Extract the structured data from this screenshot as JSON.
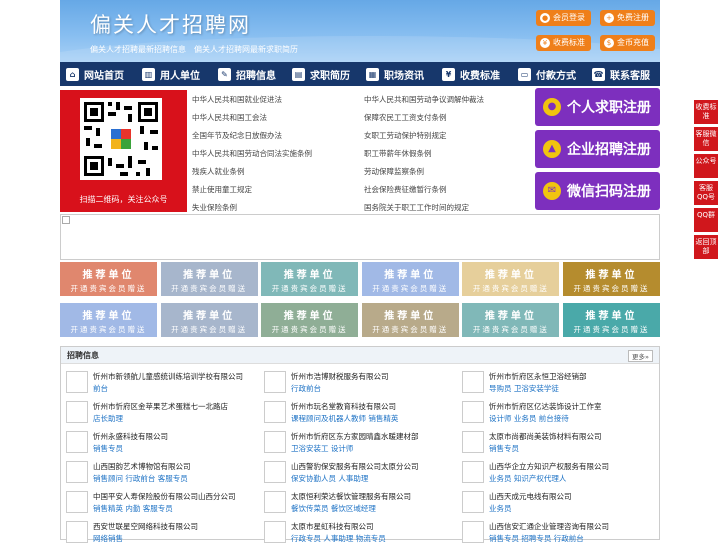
{
  "header": {
    "title": "偏关人才招聘网",
    "subtitle": "偏关人才招聘最新招聘信息　偏关人才招聘网最新求职简历",
    "buttons": [
      {
        "label": "会员登录",
        "icon": "user-icon"
      },
      {
        "label": "免费注册",
        "icon": "register-icon"
      },
      {
        "label": "收费标准",
        "icon": "price-icon"
      },
      {
        "label": "金币充值",
        "icon": "coin-icon"
      }
    ]
  },
  "nav": [
    {
      "label": "网站首页",
      "icon": "home-icon"
    },
    {
      "label": "用人单位",
      "icon": "building-icon"
    },
    {
      "label": "招聘信息",
      "icon": "recruit-icon"
    },
    {
      "label": "求职简历",
      "icon": "resume-icon"
    },
    {
      "label": "职场资讯",
      "icon": "news-icon"
    },
    {
      "label": "收费标准",
      "icon": "price-icon"
    },
    {
      "label": "付款方式",
      "icon": "payment-icon"
    },
    {
      "label": "联系客服",
      "icon": "phone-icon"
    }
  ],
  "qr": {
    "caption": "扫描二维码，关注公众号"
  },
  "laws": [
    "中华人民共和国就业促进法",
    "中华人民共和国劳动争议调解仲裁法",
    "中华人民共和国工会法",
    "保障农民工工资支付条例",
    "全国年节及纪念日放假办法",
    "女职工劳动保护特别规定",
    "中华人民共和国劳动合同法实施条例",
    "职工带薪年休假条例",
    "残疾人就业条例",
    "劳动保障监察条例",
    "禁止使用童工规定",
    "社会保险费征缴暂行条例",
    "失业保险条例",
    "国务院关于职工工作时间的规定"
  ],
  "register": [
    {
      "label": "个人求职注册",
      "icon": "person-icon"
    },
    {
      "label": "企业招聘注册",
      "icon": "company-icon"
    },
    {
      "label": "微信扫码注册",
      "icon": "wechat-icon"
    }
  ],
  "promo": {
    "title": "推荐单位",
    "sub": "开通贵宾会员赠送",
    "colors": [
      "#e0876e",
      "#a7b6cc",
      "#80b8b8",
      "#a1b9e6",
      "#e6cf9b",
      "#b58c2e",
      "#a1b9e6",
      "#a7b6cc",
      "#8fae96",
      "#b8aa8a",
      "#80b8b8",
      "#4aa9a9"
    ]
  },
  "jobs": {
    "title": "招聘信息",
    "more": "更多»",
    "items": [
      {
        "company": "忻州市新领航儿童感统训练培训学校有限公司",
        "posts": "前台"
      },
      {
        "company": "忻州市浩博财税服务有限公司",
        "posts": "行政前台"
      },
      {
        "company": "忻州市忻府区永恒卫浴经销部",
        "posts": "导购员 卫浴安装学徒"
      },
      {
        "company": "忻州市忻府区金苹果艺术蛋糕七一北路店",
        "posts": "店长助理"
      },
      {
        "company": "忻州市玩名堂教育科技有限公司",
        "posts": "课程顾问及机器人教师 销售精英"
      },
      {
        "company": "忻州市忻府区亿达装饰设计工作室",
        "posts": "设计师 业务员 前台接待"
      },
      {
        "company": "忻州永盛科技有限公司",
        "posts": "销售专员"
      },
      {
        "company": "忻州市忻府区东方家园晴鑫水暖建材部",
        "posts": "卫浴安装工 设计师"
      },
      {
        "company": "太原市尚都尚美装饰材料有限公司",
        "posts": "销售专员"
      },
      {
        "company": "山西国韵艺术博物馆有限公司",
        "posts": "销售顾问 行政前台 客服专员"
      },
      {
        "company": "山西警豹保安服务有限公司太原分公司",
        "posts": "保安协勤人员 人事助理"
      },
      {
        "company": "山西华企立方知识产权服务有限公司",
        "posts": "业务员 知识产权代理人"
      },
      {
        "company": "中国平安人寿保险股份有限公司山西分公司",
        "posts": "销售精英 内勤 客服专员"
      },
      {
        "company": "太原恒利荣达餐饮管理服务有限公司",
        "posts": "餐饮传菜员 餐饮区域经理"
      },
      {
        "company": "山西天成元电线有限公司",
        "posts": "业务员"
      },
      {
        "company": "西安世联星空网络科技有限公司",
        "posts": "网络销售"
      },
      {
        "company": "太原市星虹科技有限公司",
        "posts": "行政专员 人事助理 物流专员"
      },
      {
        "company": "山西信安汇通企业管理咨询有限公司",
        "posts": "销售专员 招聘专员 行政前台"
      }
    ]
  },
  "side": [
    "收费标准",
    "客服微信",
    "公众号",
    "客服QQ号",
    "QQ群",
    "返回顶部"
  ]
}
